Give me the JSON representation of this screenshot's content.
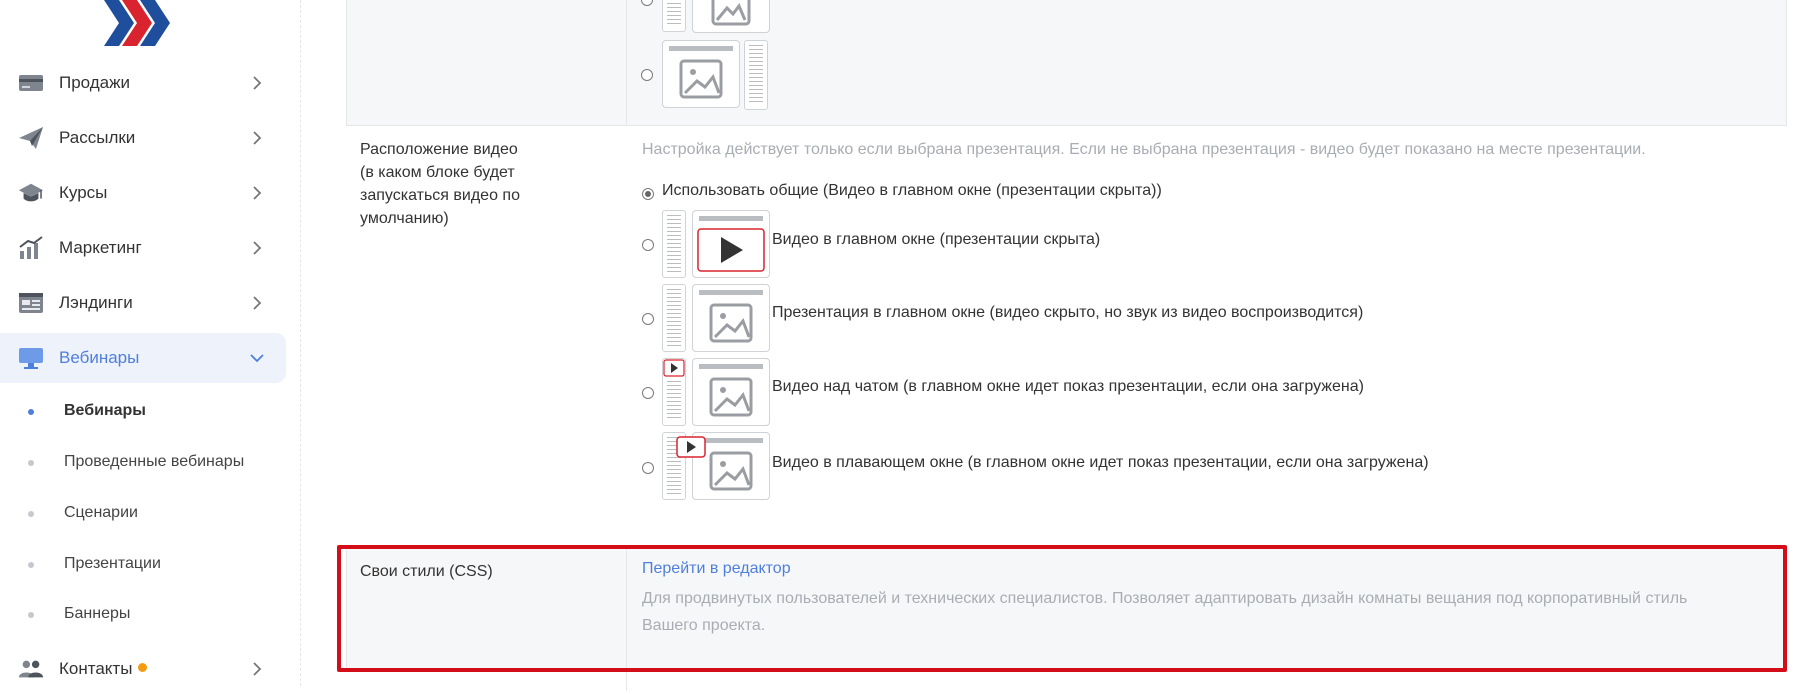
{
  "sidebar": {
    "items": [
      {
        "label": "Продажи",
        "icon": "card-icon"
      },
      {
        "label": "Рассылки",
        "icon": "paper-plane-icon"
      },
      {
        "label": "Курсы",
        "icon": "graduation-cap-icon"
      },
      {
        "label": "Маркетинг",
        "icon": "bar-chart-icon"
      },
      {
        "label": "Лэндинги",
        "icon": "landing-page-icon"
      },
      {
        "label": "Вебинары",
        "icon": "monitor-icon"
      }
    ],
    "webinar_sub": [
      {
        "label": "Вебинары"
      },
      {
        "label": "Проведенные вебинары"
      },
      {
        "label": "Сценарии"
      },
      {
        "label": "Презентации"
      },
      {
        "label": "Баннеры"
      }
    ],
    "contacts": {
      "label": "Контакты",
      "icon": "contacts-icon"
    }
  },
  "video_setting": {
    "label": "Расположение видео\n(в каком блоке будет запускаться видео по умолчанию)",
    "label_lines": [
      "Расположение видео",
      "(в каком блоке будет",
      "запускаться видео по",
      "умолчанию)"
    ],
    "hint": "Настройка действует только если выбрана презентация. Если не выбрана презентация - видео будет показано на месте презентации.",
    "options": [
      {
        "label": "Использовать общие (Видео в главном окне (презентации скрыта))",
        "checked": true
      },
      {
        "label": "Видео в главном окне (презентации скрыта)",
        "checked": false
      },
      {
        "label": "Презентация в главном окне (видео скрыто, но звук из видео воспроизводится)",
        "checked": false
      },
      {
        "label": "Видео над чатом (в главном окне идет показ презентации, если она загружена)",
        "checked": false
      },
      {
        "label": "Видео в плавающем окне (в главном окне идет показ презентации, если она загружена)",
        "checked": false
      }
    ]
  },
  "css_setting": {
    "label": "Свои стили (CSS)",
    "link": "Перейти в редактор",
    "hint_lines": [
      "Для продвинутых пользователей и технических специалистов. Позволяет адаптировать дизайн комнаты вещания под корпоративный стиль",
      "Вашего проекта."
    ]
  },
  "colors": {
    "accent": "#4f7fdc",
    "highlight": "#d40e19",
    "logo_blue": "#1f4f9c",
    "logo_red": "#d9232e"
  }
}
